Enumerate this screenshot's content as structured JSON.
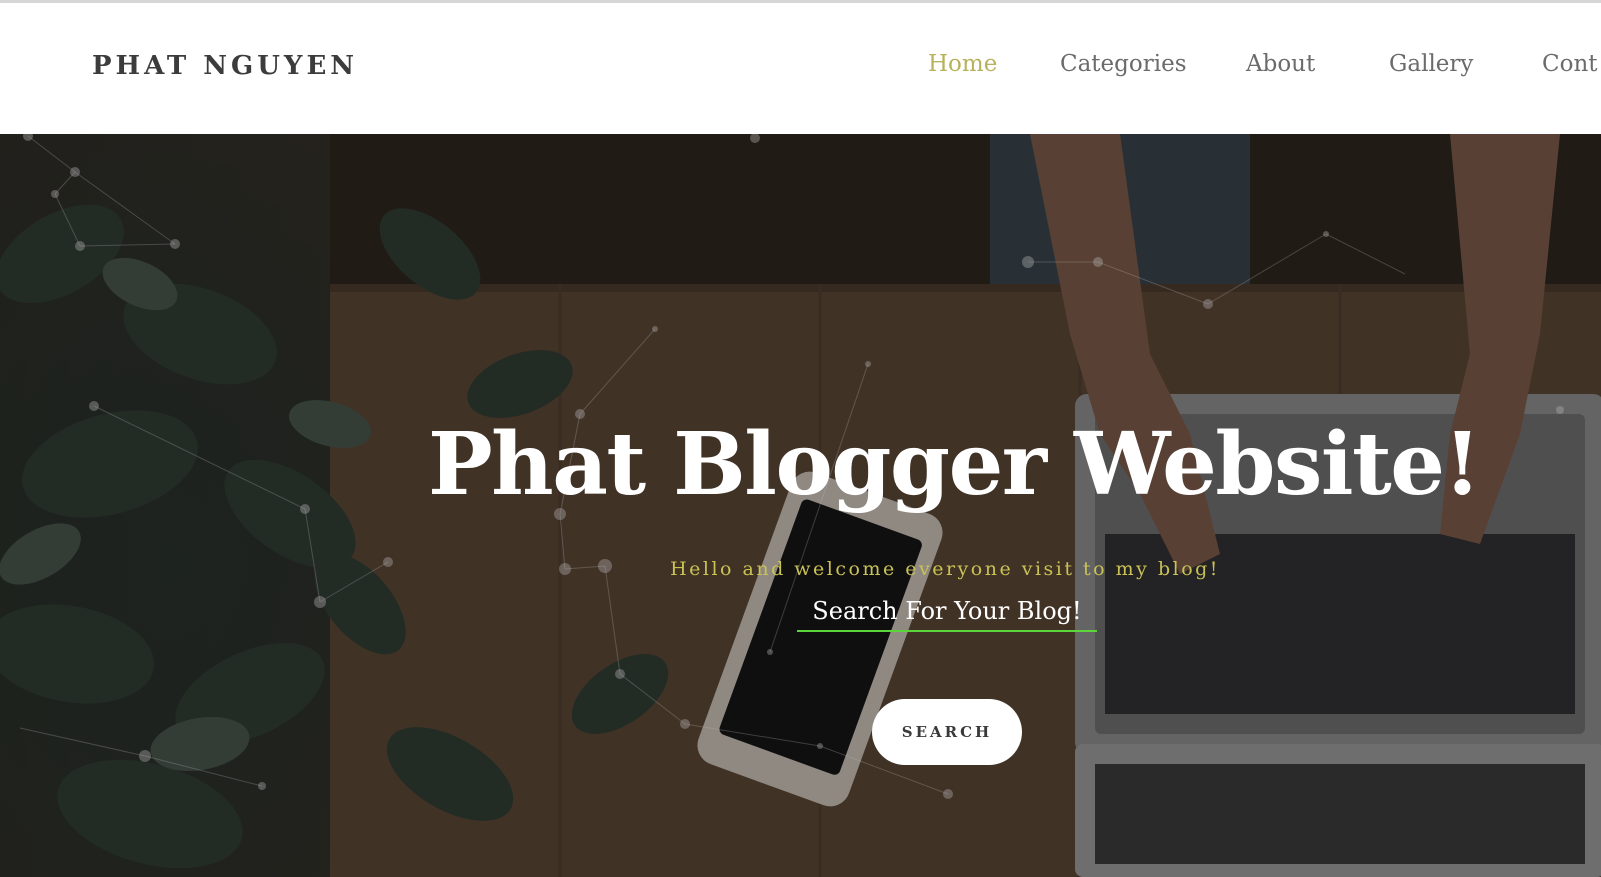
{
  "navbar": {
    "brand": "PHAT NGUYEN",
    "links": [
      {
        "label": "Home",
        "active": true
      },
      {
        "label": "Categories",
        "active": false
      },
      {
        "label": "About",
        "active": false
      },
      {
        "label": "Gallery",
        "active": false
      },
      {
        "label": "Cont",
        "active": false
      }
    ]
  },
  "hero": {
    "title": "Phat Blogger Website!",
    "subtitle": "Hello and welcome everyone visit to my blog!",
    "search_placeholder": "Search For Your Blog!",
    "search_button": "SEARCH",
    "background": "photo: hands typing on laptop at wooden desk with smartphone and eucalyptus plant, network particle overlay"
  },
  "colors": {
    "nav_active": "#b8b25c",
    "nav_text": "#6b6b6b",
    "brand_text": "#3c3c3c",
    "subtitle": "#c9c255",
    "search_underline": "#5cd43c",
    "button_bg": "#ffffff"
  }
}
